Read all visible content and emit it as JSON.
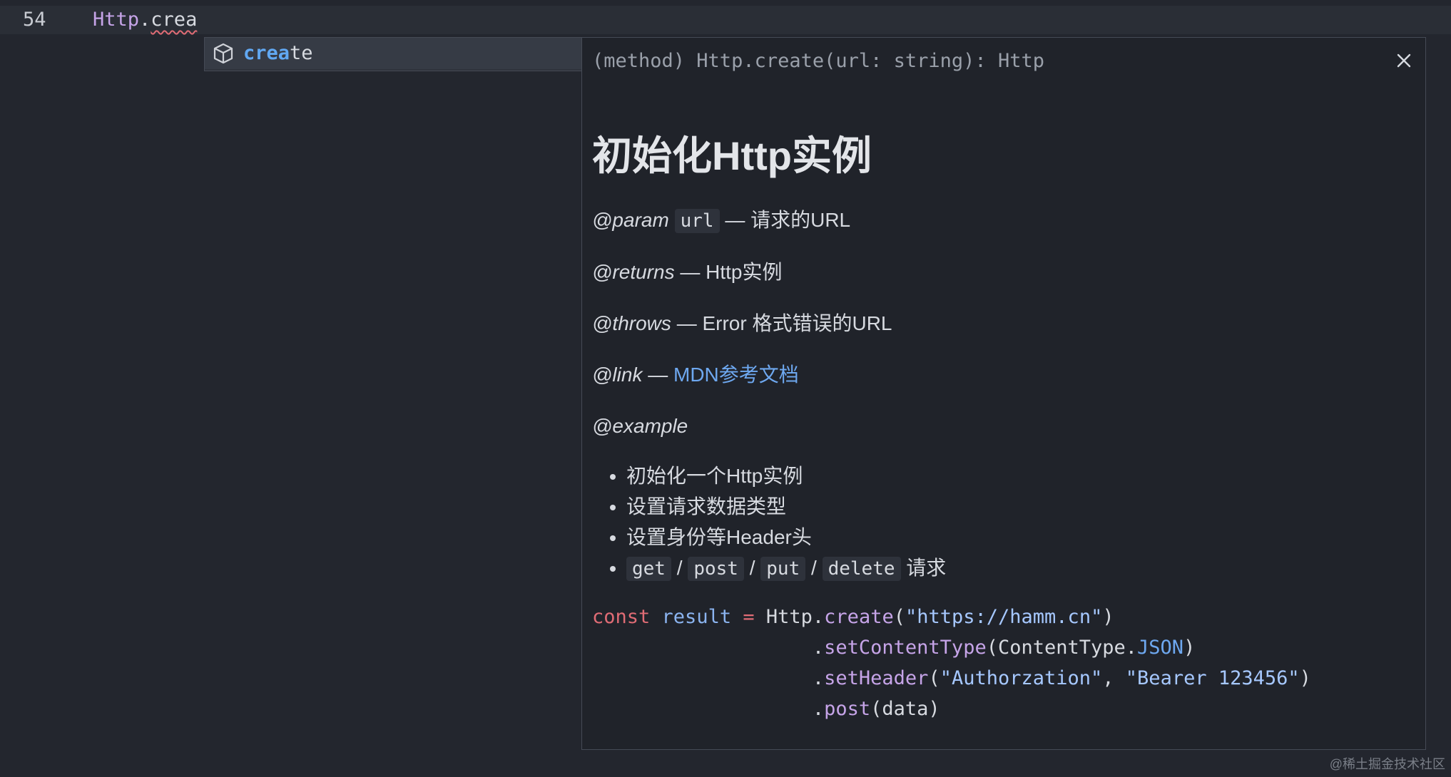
{
  "editor": {
    "line_number": "54",
    "code_class": "Http",
    "code_dot": ".",
    "code_partial": "crea"
  },
  "suggest": {
    "icon": "cube-icon",
    "label_match": "crea",
    "label_rest": "te"
  },
  "details": {
    "signature": "(method) Http.create(url: string): Http",
    "close_icon": "close-icon",
    "title": "初始化Http实例",
    "param": {
      "tag": "@param",
      "name": "url",
      "text": "— 请求的URL"
    },
    "returns": {
      "tag": "@returns",
      "text": "— Http实例"
    },
    "throws": {
      "tag": "@throws",
      "text": "— Error 格式错误的URL"
    },
    "link": {
      "tag": "@link",
      "sep": "—",
      "text": "MDN参考文档"
    },
    "example": {
      "tag": "@example"
    },
    "list": [
      "初始化一个Http实例",
      "设置请求数据类型",
      "设置身份等Header头"
    ],
    "methods_item": {
      "get": "get",
      "post": "post",
      "put": "put",
      "delete": "delete",
      "slash": "/",
      "suffix": "请求"
    },
    "code": {
      "l1_const": "const",
      "l1_var": "result",
      "l1_eq": "=",
      "l1_obj": "Http.",
      "l1_fn": "create",
      "l1_open": "(",
      "l1_str": "\"https://hamm.cn\"",
      "l1_close": ")",
      "l2_dot": ".",
      "l2_fn": "setContentType",
      "l2_open": "(ContentType.",
      "l2_const": "JSON",
      "l2_close": ")",
      "l3_dot": ".",
      "l3_fn": "setHeader",
      "l3_open": "(",
      "l3_str1": "\"Authorzation\"",
      "l3_comma": ", ",
      "l3_str2": "\"Bearer 123456\"",
      "l3_close": ")",
      "l4_dot": ".",
      "l4_fn": "post",
      "l4_args": "(data)"
    }
  },
  "watermark": "@稀土掘金技术社区"
}
